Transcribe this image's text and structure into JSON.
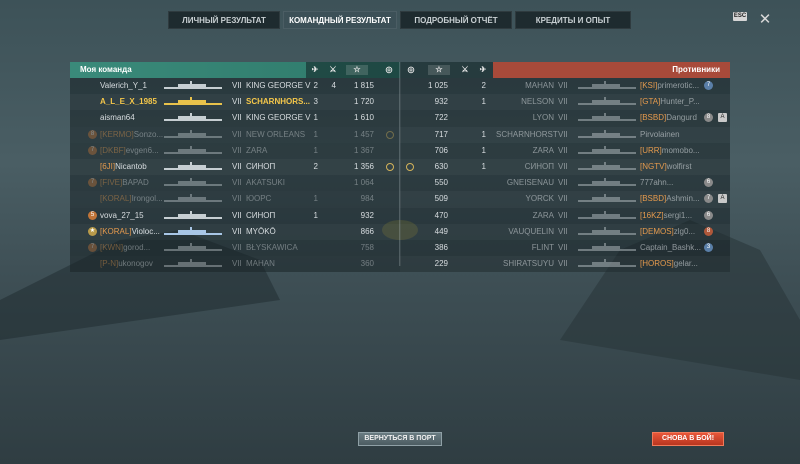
{
  "tabs": [
    "ЛИЧНЫЙ РЕЗУЛЬТАТ",
    "КОМАНДНЫЙ РЕЗУЛЬТАТ",
    "ПОДРОБНЫЙ ОТЧЁТ",
    "КРЕДИТЫ И ОПЫТ"
  ],
  "active_tab": 1,
  "esc_label": "ESC",
  "close_label": "✕",
  "my_team": {
    "title": "Моя команда",
    "rows": [
      {
        "badge": "",
        "clan": "",
        "name": "Valerich_Y_1",
        "tier": "VII",
        "ship": "KING GEORGE V",
        "c1": "2",
        "c2": "4",
        "score": "1 815",
        "medal": false,
        "dead": false,
        "me": false,
        "sil": "grey"
      },
      {
        "badge": "",
        "clan": "",
        "name": "A_L_E_X_1985",
        "tier": "VII",
        "ship": "SCHARNHORS...",
        "c1": "3",
        "c2": "",
        "score": "1 720",
        "medal": false,
        "dead": false,
        "me": true,
        "sil": "gold"
      },
      {
        "badge": "",
        "clan": "",
        "name": "aisman64",
        "tier": "VII",
        "ship": "KING GEORGE V",
        "c1": "1",
        "c2": "",
        "score": "1 610",
        "medal": false,
        "dead": false,
        "me": false,
        "sil": "grey"
      },
      {
        "badge": "8",
        "clan": "[KERMO]",
        "name": "Sonzo...",
        "tier": "VII",
        "ship": "NEW ORLEANS",
        "c1": "1",
        "c2": "",
        "score": "1 457",
        "medal": true,
        "dead": true,
        "me": false,
        "sil": "grey"
      },
      {
        "badge": "7",
        "clan": "[DKBF]",
        "name": "evgen6...",
        "tier": "VII",
        "ship": "ZARA",
        "c1": "1",
        "c2": "",
        "score": "1 367",
        "medal": false,
        "dead": true,
        "me": false,
        "sil": "grey"
      },
      {
        "badge": "",
        "clan": "[6JI]",
        "name": "Nicantob",
        "tier": "VII",
        "ship": "СИНОП",
        "c1": "2",
        "c2": "",
        "score": "1 356",
        "medal": true,
        "dead": false,
        "me": false,
        "sil": "grey"
      },
      {
        "badge": "7",
        "clan": "[FIVE]",
        "name": "BAPAD",
        "tier": "VII",
        "ship": "AKATSUKI",
        "c1": "",
        "c2": "",
        "score": "1 064",
        "medal": false,
        "dead": true,
        "me": false,
        "sil": "grey"
      },
      {
        "badge": "",
        "clan": "[KORAL]",
        "name": "Irongol...",
        "tier": "VII",
        "ship": "ЮОРС",
        "c1": "1",
        "c2": "",
        "score": "984",
        "medal": false,
        "dead": true,
        "me": false,
        "sil": "grey"
      },
      {
        "badge": "5",
        "clan": "",
        "name": "vova_27_15",
        "tier": "VII",
        "ship": "СИНОП",
        "c1": "1",
        "c2": "",
        "score": "932",
        "medal": false,
        "dead": false,
        "me": false,
        "sil": "grey"
      },
      {
        "badge": "★",
        "clan": "[KORAL]",
        "name": "Violoc...",
        "tier": "VII",
        "ship": "MYŌKŌ",
        "c1": "",
        "c2": "",
        "score": "866",
        "medal": false,
        "dead": false,
        "me": false,
        "sil": "blue"
      },
      {
        "badge": "7",
        "clan": "[KWN]",
        "name": "gorod...",
        "tier": "VII",
        "ship": "BŁYSKAWICA",
        "c1": "",
        "c2": "",
        "score": "758",
        "medal": false,
        "dead": true,
        "me": false,
        "sil": "grey"
      },
      {
        "badge": "",
        "clan": "[P-N]",
        "name": "ukonogov",
        "tier": "VII",
        "ship": "MAHAN",
        "c1": "",
        "c2": "",
        "score": "360",
        "medal": false,
        "dead": true,
        "me": false,
        "sil": "grey"
      }
    ]
  },
  "enemy_team": {
    "title": "Противники",
    "rows": [
      {
        "medal": false,
        "score": "1 025",
        "c1": "2",
        "ship": "MAHAN",
        "tier": "VII",
        "clan": "[KSI]",
        "name": "primerotic...",
        "badge": "7",
        "badge_color": "blue",
        "square": false
      },
      {
        "medal": false,
        "score": "932",
        "c1": "1",
        "ship": "NELSON",
        "tier": "VII",
        "clan": "[GTA]",
        "name": "Hunter_P...",
        "badge": "",
        "badge_color": "",
        "square": false
      },
      {
        "medal": false,
        "score": "722",
        "c1": "",
        "ship": "LYON",
        "tier": "VII",
        "clan": "[BSBD]",
        "name": "Dangurd",
        "badge": "8",
        "badge_color": "grey",
        "square": true
      },
      {
        "medal": false,
        "score": "717",
        "c1": "1",
        "ship": "SCHARNHORST",
        "tier": "VII",
        "clan": "",
        "name": "Pirvolainen",
        "badge": "",
        "badge_color": "",
        "square": false
      },
      {
        "medal": false,
        "score": "706",
        "c1": "1",
        "ship": "ZARA",
        "tier": "VII",
        "clan": "[URR]",
        "name": "momobo...",
        "badge": "",
        "badge_color": "",
        "square": false
      },
      {
        "medal": true,
        "score": "630",
        "c1": "1",
        "ship": "СИНОП",
        "tier": "VII",
        "clan": "[NGTV]",
        "name": "wolfirst",
        "badge": "",
        "badge_color": "",
        "square": false
      },
      {
        "medal": false,
        "score": "550",
        "c1": "",
        "ship": "GNEISENAU",
        "tier": "VII",
        "clan": "",
        "name": "777ahn...",
        "badge": "6",
        "badge_color": "grey",
        "square": false
      },
      {
        "medal": false,
        "score": "509",
        "c1": "",
        "ship": "YORCK",
        "tier": "VII",
        "clan": "[BSBD]",
        "name": "Ashmin...",
        "badge": "7",
        "badge_color": "grey",
        "square": true
      },
      {
        "medal": false,
        "score": "470",
        "c1": "",
        "ship": "ZARA",
        "tier": "VII",
        "clan": "[16KZ]",
        "name": "sergi1...",
        "badge": "6",
        "badge_color": "grey",
        "square": false
      },
      {
        "medal": false,
        "score": "449",
        "c1": "",
        "ship": "VAUQUELIN",
        "tier": "VII",
        "clan": "[DEMOS]",
        "name": "zlg0...",
        "badge": "8",
        "badge_color": "red",
        "square": false
      },
      {
        "medal": false,
        "score": "386",
        "c1": "",
        "ship": "FLINT",
        "tier": "VII",
        "clan": "",
        "name": "Captain_Bashk...",
        "badge": "3",
        "badge_color": "blue",
        "square": false
      },
      {
        "medal": false,
        "score": "229",
        "c1": "",
        "ship": "SHIRATSUYU",
        "tier": "VII",
        "clan": "[HOROS]",
        "name": "gelar...",
        "badge": "",
        "badge_color": "",
        "square": false
      }
    ]
  },
  "buttons": {
    "port": "ВЕРНУТЬСЯ В ПОРТ",
    "again": "СНОВА В БОЙ!"
  }
}
